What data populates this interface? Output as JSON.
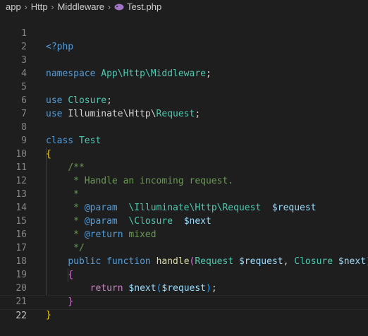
{
  "breadcrumb": {
    "items": [
      "app",
      "Http",
      "Middleware"
    ],
    "file": "Test.php"
  },
  "editor": {
    "line_numbers": [
      "1",
      "2",
      "3",
      "4",
      "5",
      "6",
      "7",
      "8",
      "9",
      "10",
      "11",
      "12",
      "13",
      "14",
      "15",
      "16",
      "17",
      "18",
      "19",
      "20",
      "21",
      "22"
    ],
    "active_line": "22",
    "code": {
      "l1_open_tag": "<?php",
      "l3_namespace_kw": "namespace",
      "l3_namespace_name": "App\\Http\\Middleware",
      "l3_semi": ";",
      "l5_use_kw": "use",
      "l5_class": "Closure",
      "l5_semi": ";",
      "l6_use_kw": "use",
      "l6_ns": "Illuminate\\Http\\",
      "l6_class": "Request",
      "l6_semi": ";",
      "l8_class_kw": "class",
      "l8_class_name": "Test",
      "l9_brace": "{",
      "l10_doc": "/**",
      "l11_doc": " * Handle an incoming request.",
      "l12_doc": " *",
      "l13_doc_star": " * ",
      "l13_tag": "@param",
      "l13_type": "  \\Illuminate\\Http\\Request",
      "l13_var": "  $request",
      "l14_doc_star": " * ",
      "l14_tag": "@param",
      "l14_type": "  \\Closure",
      "l14_var": "  $next",
      "l15_doc_star": " * ",
      "l15_tag": "@return",
      "l15_type": " mixed",
      "l16_doc": " */",
      "l17_public": "public",
      "l17_function": "function",
      "l17_name": "handle",
      "l17_paren_open": "(",
      "l17_type1": "Request",
      "l17_var1": "$request",
      "l17_comma": ", ",
      "l17_type2": "Closure",
      "l17_var2": "$next",
      "l17_paren_close": ")",
      "l18_brace": "{",
      "l19_return": "return",
      "l19_var": "$next",
      "l19_paren_open": "(",
      "l19_arg": "$request",
      "l19_paren_close": ")",
      "l19_semi": ";",
      "l20_brace": "}",
      "l21_brace": "}"
    }
  },
  "colors": {
    "background": "#1e1e1e",
    "keyword": "#569cd6",
    "control": "#c586c0",
    "type": "#4ec9b0",
    "variable": "#9cdcfe",
    "function": "#dcdcaa",
    "comment": "#6a9955",
    "bracket_level1": "#ffd700",
    "bracket_level2": "#da70d6",
    "bracket_level3": "#179fff"
  },
  "icons": {
    "file_icon": "php-elephant-icon",
    "separator": "chevron-right-icon"
  }
}
